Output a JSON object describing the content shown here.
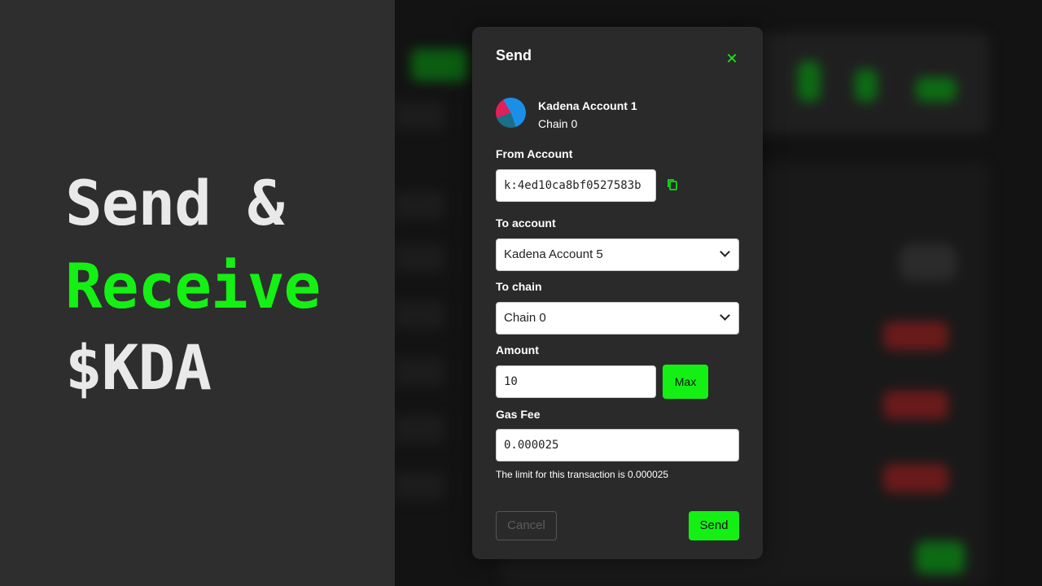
{
  "promo": {
    "line1": "Send &",
    "line2": "Receive",
    "line3": "$KDA"
  },
  "modal": {
    "title": "Send",
    "close_icon": "close-icon",
    "account": {
      "name": "Kadena Account 1",
      "chain": "Chain 0"
    },
    "from_account": {
      "label": "From Account",
      "value": "k:4ed10ca8bf0527583b",
      "copy_icon": "copy-icon"
    },
    "to_account": {
      "label": "To account",
      "selected": "Kadena Account 5"
    },
    "to_chain": {
      "label": "To chain",
      "selected": "Chain 0"
    },
    "amount": {
      "label": "Amount",
      "value": "10",
      "max_label": "Max"
    },
    "gas_fee": {
      "label": "Gas Fee",
      "value": "0.000025",
      "hint": "The limit for this transaction is 0.000025"
    },
    "buttons": {
      "cancel": "Cancel",
      "send": "Send"
    }
  },
  "colors": {
    "accent": "#14f014",
    "promo_background": "#2e2e2e",
    "modal_background": "#2a2a2a"
  }
}
